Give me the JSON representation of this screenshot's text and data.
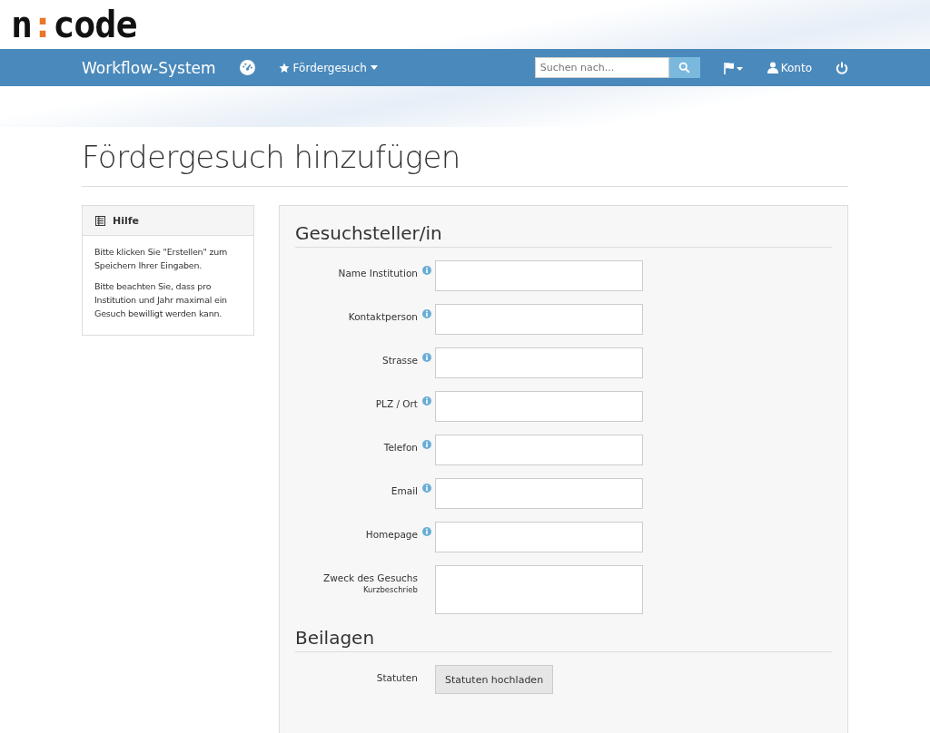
{
  "logo": {
    "parts": [
      {
        "text": "n",
        "color": "#111111"
      },
      {
        "text": ":",
        "color": "#e8762b"
      },
      {
        "text": "code",
        "color": "#111111"
      }
    ]
  },
  "navbar": {
    "brand": "Workflow-System",
    "menu": "Fördergesuch",
    "search": {
      "placeholder": "Suchen nach..."
    },
    "account": "Konto"
  },
  "page_title": "Fördergesuch hinzufügen",
  "help": {
    "title": "Hilfe",
    "paragraphs": [
      "Bitte klicken Sie \"Erstellen\" zum Speichern Ihrer Eingaben.",
      "Bitte beachten Sie, dass pro Institution und Jahr maximal ein Gesuch bewilligt werden kann."
    ]
  },
  "sections": [
    {
      "title": "Gesuchsteller/in",
      "fields": [
        {
          "kind": "text",
          "label": "Name Institution",
          "info": true
        },
        {
          "kind": "text",
          "label": "Kontaktperson",
          "info": true
        },
        {
          "kind": "text",
          "label": "Strasse",
          "info": true
        },
        {
          "kind": "text",
          "label": "PLZ / Ort",
          "info": true
        },
        {
          "kind": "text",
          "label": "Telefon",
          "info": true
        },
        {
          "kind": "text",
          "label": "Email",
          "info": true
        },
        {
          "kind": "text",
          "label": "Homepage",
          "info": true
        },
        {
          "kind": "textarea",
          "label": "Zweck des Gesuchs",
          "hint": "Kurzbeschrieb",
          "info": false
        }
      ]
    },
    {
      "title": "Beilagen",
      "fields": [
        {
          "kind": "upload",
          "label": "Statuten",
          "button": "Statuten hochladen",
          "info": false
        }
      ]
    }
  ]
}
